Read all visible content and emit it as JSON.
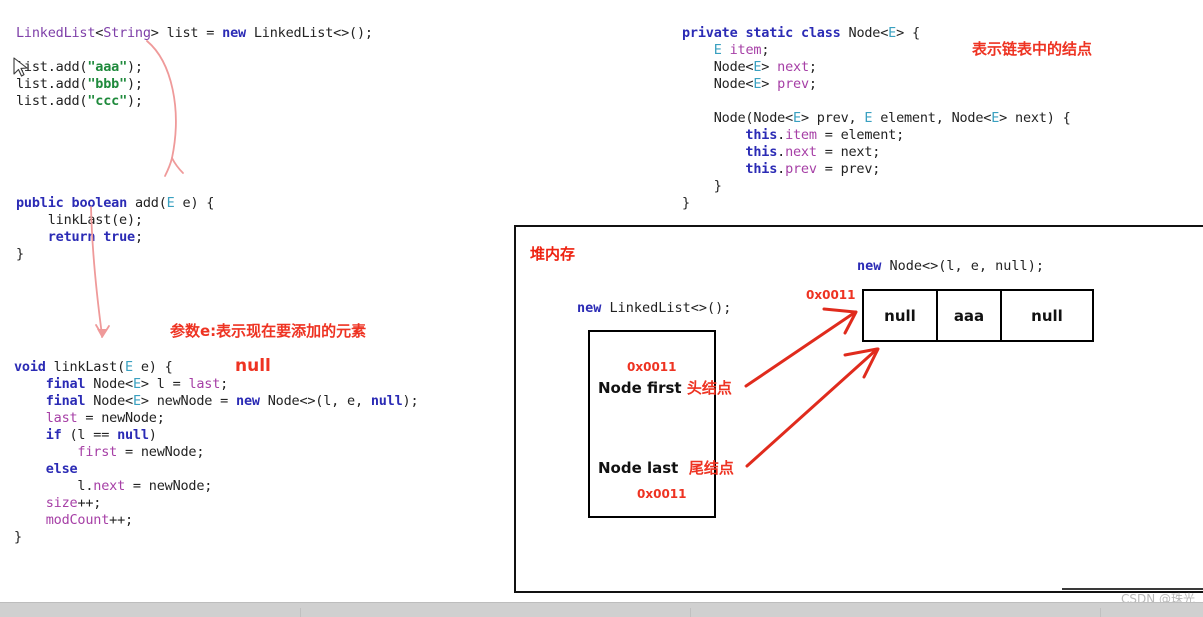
{
  "left_code_1": {
    "lines": [
      "LinkedList<String> list = new LinkedList<>();",
      "",
      "list.add(\"aaa\");",
      "list.add(\"bbb\");",
      "list.add(\"ccc\");"
    ]
  },
  "left_code_2": {
    "lines": [
      "public boolean add(E e) {",
      "    linkLast(e);",
      "    return true;",
      "}"
    ]
  },
  "left_code_3": {
    "lines": [
      "void linkLast(E e) {",
      "    final Node<E> l = last;",
      "    final Node<E> newNode = new Node<>(l, e, null);",
      "    last = newNode;",
      "    if (l == null)",
      "        first = newNode;",
      "    else",
      "        l.next = newNode;",
      "    size++;",
      "    modCount++;",
      "}"
    ]
  },
  "right_code": {
    "lines": [
      "private static class Node<E> {",
      "    E item;",
      "    Node<E> next;",
      "    Node<E> prev;",
      "",
      "    Node(Node<E> prev, E element, Node<E> next) {",
      "        this.item = element;",
      "        this.next = next;",
      "        this.prev = prev;",
      "    }",
      "}"
    ]
  },
  "annotations": {
    "node_class_note": "表示链表中的结点",
    "param_note": "参数e:表示现在要添加的元素",
    "null_hint": "null"
  },
  "heap": {
    "title": "堆内存",
    "list_construct_label": "new LinkedList<>();",
    "list_construct_keyword": "new",
    "first_addr": "0x0011",
    "first_label": "Node first",
    "first_label_cn": "头结点",
    "last_label": "Node last",
    "last_label_cn": "尾结点",
    "last_addr": "0x0011",
    "node_addr": "0x0011",
    "node_construct_label": "new Node<>(l, e, null);",
    "node_construct_keyword": "new",
    "node_cells": [
      "null",
      "aaa",
      "null"
    ]
  },
  "watermark": {
    "text": "CSDN @珠光"
  },
  "colors": {
    "annotation_red": "#ee3322",
    "keyword_blue": "#2b2bb5",
    "keyword_purple": "#6a2fa0",
    "string_green": "#1f8a3c",
    "generic_cyan": "#39a0c0",
    "field_magenta": "#a63fa6",
    "arrow_red": "#e02b1d",
    "arrow_pink": "#ef9a9a"
  }
}
